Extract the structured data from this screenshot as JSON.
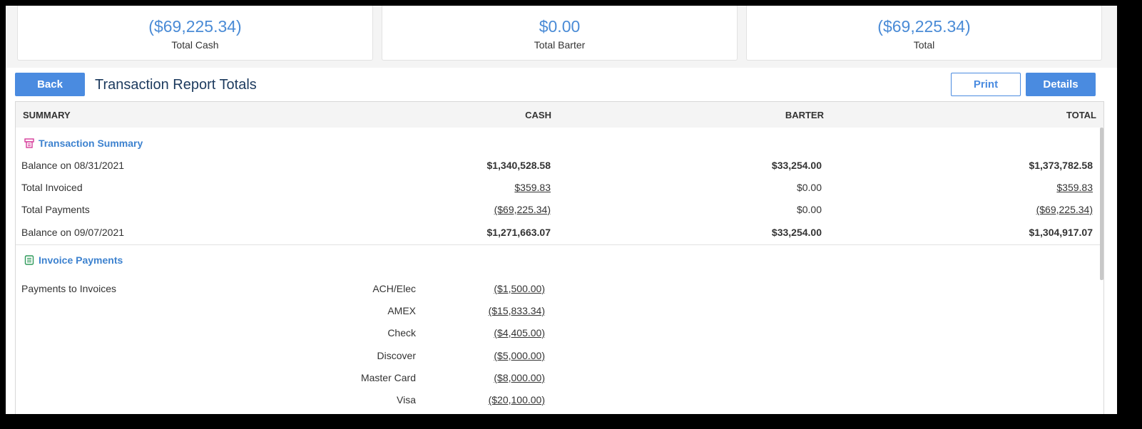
{
  "cards": [
    {
      "amount": "($69,225.34)",
      "label": "Total Cash"
    },
    {
      "amount": "$0.00",
      "label": "Total Barter"
    },
    {
      "amount": "($69,225.34)",
      "label": "Total"
    }
  ],
  "toolbar": {
    "back_label": "Back",
    "title": "Transaction Report Totals",
    "print_label": "Print",
    "details_label": "Details"
  },
  "table": {
    "headers": {
      "summary": "SUMMARY",
      "cash": "CASH",
      "barter": "BARTER",
      "total": "TOTAL"
    },
    "transaction_summary": {
      "title": "Transaction Summary",
      "icon": "receipt-icon",
      "rows": [
        {
          "label": "Balance on 08/31/2021",
          "cash": "$1,340,528.58",
          "barter": "$33,254.00",
          "total": "$1,373,782.58"
        },
        {
          "label": "Total Invoiced",
          "cash": "$359.83",
          "barter": "$0.00",
          "total": "$359.83"
        },
        {
          "label": "Total Payments",
          "cash": "($69,225.34)",
          "barter": "$0.00",
          "total": "($69,225.34)"
        },
        {
          "label": "Balance on 09/07/2021",
          "cash": "$1,271,663.07",
          "barter": "$33,254.00",
          "total": "$1,304,917.07"
        }
      ]
    },
    "invoice_payments": {
      "title": "Invoice Payments",
      "icon": "invoice-icon",
      "label": "Payments to Invoices",
      "rows": [
        {
          "method": "ACH/Elec",
          "amount": "($1,500.00)"
        },
        {
          "method": "AMEX",
          "amount": "($15,833.34)"
        },
        {
          "method": "Check",
          "amount": "($4,405.00)"
        },
        {
          "method": "Discover",
          "amount": "($5,000.00)"
        },
        {
          "method": "Master Card",
          "amount": "($8,000.00)"
        },
        {
          "method": "Visa",
          "amount": "($20,100.00)"
        }
      ]
    }
  },
  "colors": {
    "accent": "#4a8be0",
    "amount_blue": "#4a8bd6",
    "title": "#1c3a5e",
    "section": "#3d82cf",
    "receipt_icon": "#d63b9a",
    "invoice_icon": "#2e9a5a"
  }
}
